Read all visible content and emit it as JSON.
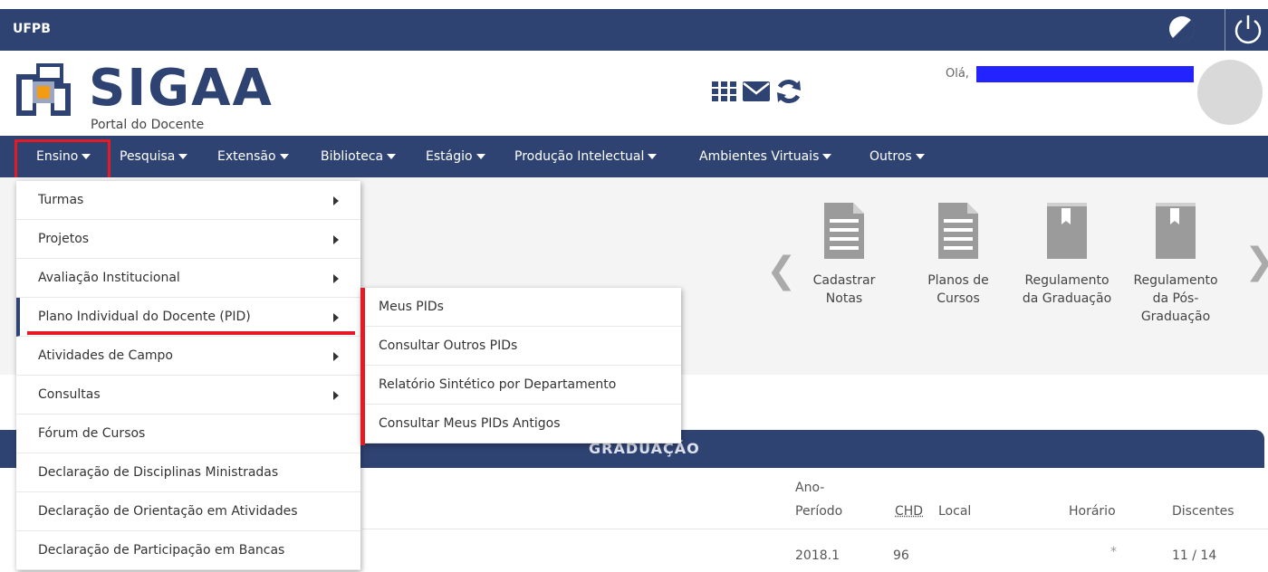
{
  "topbar": {
    "brand": "UFPB"
  },
  "header": {
    "app_name": "SIGAA",
    "portal_subtitle": "Portal do Docente",
    "greeting": "Olá,"
  },
  "nav": {
    "items": [
      {
        "label": "Ensino"
      },
      {
        "label": "Pesquisa"
      },
      {
        "label": "Extensão"
      },
      {
        "label": "Biblioteca"
      },
      {
        "label": "Estágio"
      },
      {
        "label": "Produção Intelectual"
      },
      {
        "label": "Ambientes Virtuais"
      },
      {
        "label": "Outros"
      }
    ]
  },
  "ensino_menu": {
    "items": [
      {
        "label": "Turmas"
      },
      {
        "label": "Projetos"
      },
      {
        "label": "Avaliação Institucional"
      },
      {
        "label": "Plano Individual do Docente (PID)"
      },
      {
        "label": "Atividades de Campo"
      },
      {
        "label": "Consultas"
      },
      {
        "label": "Fórum de Cursos"
      },
      {
        "label": "Declaração de Disciplinas Ministradas"
      },
      {
        "label": "Declaração de Orientação em Atividades"
      },
      {
        "label": "Declaração de Participação em Bancas"
      }
    ]
  },
  "pid_submenu": {
    "items": [
      {
        "label": "Meus PIDs"
      },
      {
        "label": "Consultar Outros PIDs"
      },
      {
        "label": "Relatório Sintético por Departamento"
      },
      {
        "label": "Consultar Meus PIDs Antigos"
      }
    ]
  },
  "quick_access": {
    "items": [
      {
        "line1": "Cadastrar",
        "line2": "Notas",
        "line3": "",
        "icon": "document-icon"
      },
      {
        "line1": "Planos de",
        "line2": "Cursos",
        "line3": "",
        "icon": "document-icon"
      },
      {
        "line1": "Regulamento",
        "line2": "da Graduação",
        "line3": "",
        "icon": "book-icon"
      },
      {
        "line1": "Regulamento",
        "line2": "da Pós-",
        "line3": "Graduação",
        "icon": "book-icon"
      }
    ]
  },
  "graduacao": {
    "title": "GRADUAÇÃO",
    "columns": {
      "ano_line1": "Ano-",
      "ano_line2": "Período",
      "chd": "CHD",
      "local": "Local",
      "horario": "Horário",
      "discentes": "Discentes"
    },
    "rows": [
      {
        "ano_periodo": "2018.1",
        "chd": "96",
        "local": "",
        "horario": "*",
        "discentes": "11 / 14"
      }
    ]
  },
  "colors": {
    "primary": "#2f4373",
    "highlight_red": "#e51b24",
    "redaction_blue": "#2323ff"
  }
}
